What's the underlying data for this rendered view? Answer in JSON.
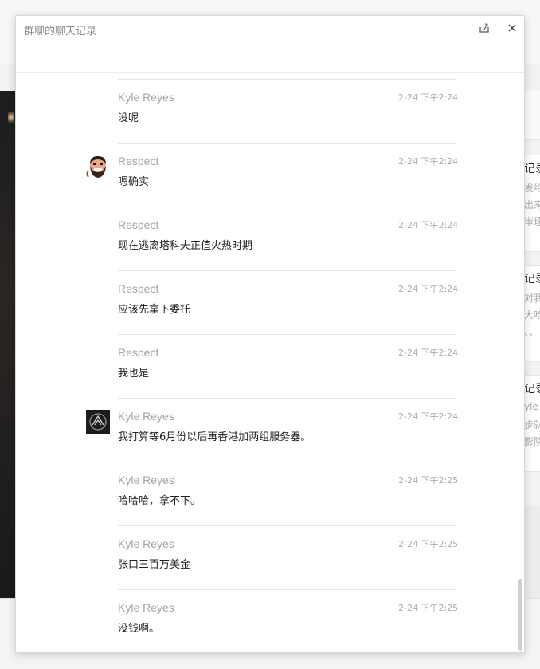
{
  "dialog": {
    "title": "群聊的聊天记录"
  },
  "background": {
    "cards": [
      {
        "title": "记录",
        "lines": [
          "发给",
          "出来",
          "审理"
        ]
      },
      {
        "title": "记录",
        "lines": [
          "对我",
          "大哈",
          "、、"
        ]
      },
      {
        "title": "记录",
        "lines": [
          "yle I",
          "步就",
          "影院"
        ]
      }
    ]
  },
  "messages": [
    {
      "name": "Kyle Reyes",
      "time": "2-24 下午2:24",
      "text": "没呢",
      "avatar": "none"
    },
    {
      "name": "Respect",
      "time": "2-24 下午2:24",
      "text": "嗯确实",
      "avatar": "bearded-man-avatar"
    },
    {
      "name": "Respect",
      "time": "2-24 下午2:24",
      "text": "现在逃离塔科夫正值火热时期",
      "avatar": "none"
    },
    {
      "name": "Respect",
      "time": "2-24 下午2:24",
      "text": "应该先拿下委托",
      "avatar": "none"
    },
    {
      "name": "Respect",
      "time": "2-24 下午2:24",
      "text": "我也是",
      "avatar": "none"
    },
    {
      "name": "Kyle Reyes",
      "time": "2-24 下午2:24",
      "text": "我打算等6月份以后再香港加两组服务器。",
      "avatar": "dark-emblem-avatar"
    },
    {
      "name": "Kyle Reyes",
      "time": "2-24 下午2:25",
      "text": "哈哈哈，拿不下。",
      "avatar": "none"
    },
    {
      "name": "Kyle Reyes",
      "time": "2-24 下午2:25",
      "text": "张口三百万美金",
      "avatar": "none"
    },
    {
      "name": "Kyle Reyes",
      "time": "2-24 下午2:25",
      "text": "没钱啊。",
      "avatar": "none"
    }
  ],
  "icons": {
    "share": "share-icon",
    "close": "close-icon"
  },
  "colors": {
    "name": "#a3a3a3",
    "time": "#aaaaaa",
    "text": "#222222",
    "divider": "#e6e6e6"
  }
}
